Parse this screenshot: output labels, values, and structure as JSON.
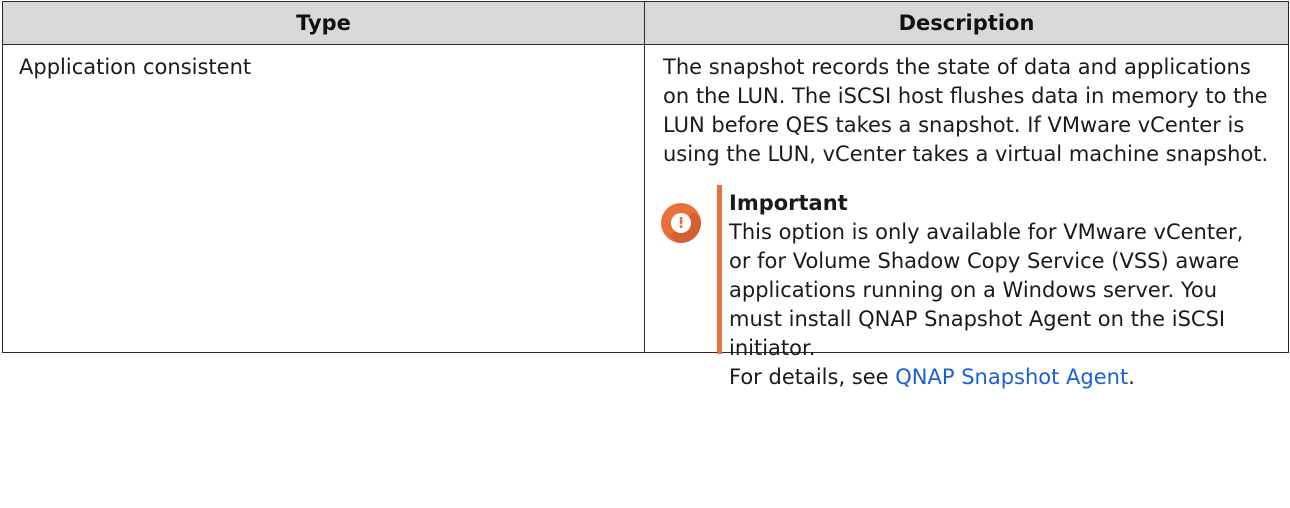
{
  "table": {
    "headers": {
      "type": "Type",
      "description": "Description"
    },
    "rows": [
      {
        "type": "Application consistent",
        "description": "The snapshot records the state of data and applications on the LUN. The iSCSI host flushes data in memory to the LUN before QES takes a snapshot. If VMware vCenter is using the LUN, vCenter takes a virtual machine snapshot.",
        "note": {
          "icon": "important-exclamation-icon",
          "title": "Important",
          "text": "This option is only available for VMware vCenter, or for Volume Shadow Copy Service (VSS) aware applications running on a Windows server. You must install QNAP Snapshot Agent on the iSCSI initiator.",
          "details_prefix": "For details, see ",
          "link_text": "QNAP Snapshot Agent",
          "details_suffix": "."
        }
      }
    ]
  },
  "colors": {
    "header_bg": "#d9d9d9",
    "accent_orange": "#e8703a",
    "link_blue": "#1a5fd6"
  }
}
